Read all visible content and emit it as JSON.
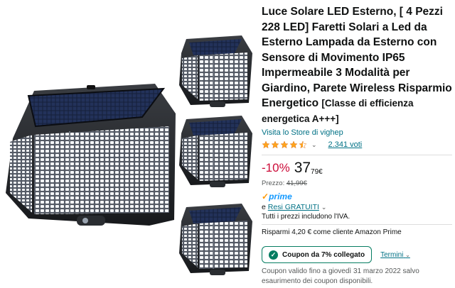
{
  "product": {
    "title": "Luce Solare LED Esterno, [ 4 Pezzi 228 LED] Faretti Solari a Led da Esterno Lampada da Esterno con Sensore di Movimento IP65 Impermeabile 3 Modalità per Giardino, Parete Wireless Risparmio Energetico",
    "title_suffix": "[Classe di efficienza energetica A+++]",
    "store_link": "Visita lo Store di vighep",
    "rating_stars": 4.5,
    "votes": "2.341 voti",
    "image_alt": "4 solar LED wall lights with motion sensor"
  },
  "price": {
    "discount": "-10%",
    "whole": "37",
    "fraction": "79",
    "currency": "€",
    "list_label": "Prezzo:",
    "list_value": "41,99€"
  },
  "delivery": {
    "prime_label": "prime",
    "returns_prefix": "e",
    "returns_link": "Resi GRATUITI",
    "vat_note": "Tutti i prezzi includono l'IVA.",
    "savings_note": "Risparmi 4,20 € come cliente Amazon Prime"
  },
  "coupon": {
    "button_label": "Coupon da 7% collegato",
    "terms_label": "Termini",
    "note": "Coupon valido fino a giovedì 31 marzo 2022 salvo esaurimento dei coupon disponibili."
  },
  "colors": {
    "link": "#007185",
    "discount": "#CC0C39",
    "star": "#FFA41C",
    "coupon_green": "#067D62",
    "prime_blue": "#1399FF"
  }
}
